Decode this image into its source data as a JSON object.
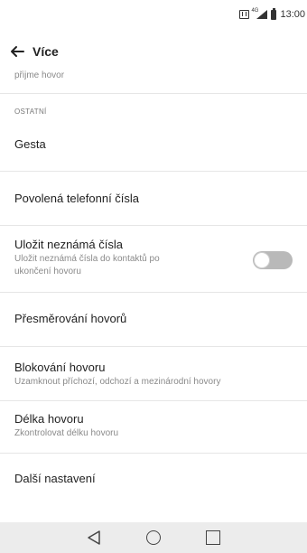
{
  "status_bar": {
    "time": "13:00"
  },
  "header": {
    "title": "Více"
  },
  "list": {
    "partial_item": "přijme hovor",
    "section": "OSTATNÍ",
    "items": [
      {
        "title": "Gesta"
      },
      {
        "title": "Povolená telefonní čísla"
      },
      {
        "title": "Uložit neznámá čísla",
        "subtitle_line1": "Uložit neznámá čísla do kontaktů po",
        "subtitle_line2": "ukončení hovoru",
        "toggle": "off"
      },
      {
        "title": "Přesměrování hovorů"
      },
      {
        "title": "Blokování hovoru",
        "subtitle": "Uzamknout příchozí, odchozí a mezinárodní hovory"
      },
      {
        "title": "Délka hovoru",
        "subtitle": "Zkontrolovat délku hovoru"
      },
      {
        "title": "Další nastavení"
      }
    ]
  },
  "colors": {
    "toggle_off": "#b9b9b9",
    "nav_bar": "#ececec",
    "divider": "#e6e6e6"
  },
  "icons": [
    "nfc-icon",
    "signal-icon",
    "battery-icon",
    "back-arrow-icon",
    "nav-back-icon",
    "nav-home-icon",
    "nav-recent-icon"
  ]
}
